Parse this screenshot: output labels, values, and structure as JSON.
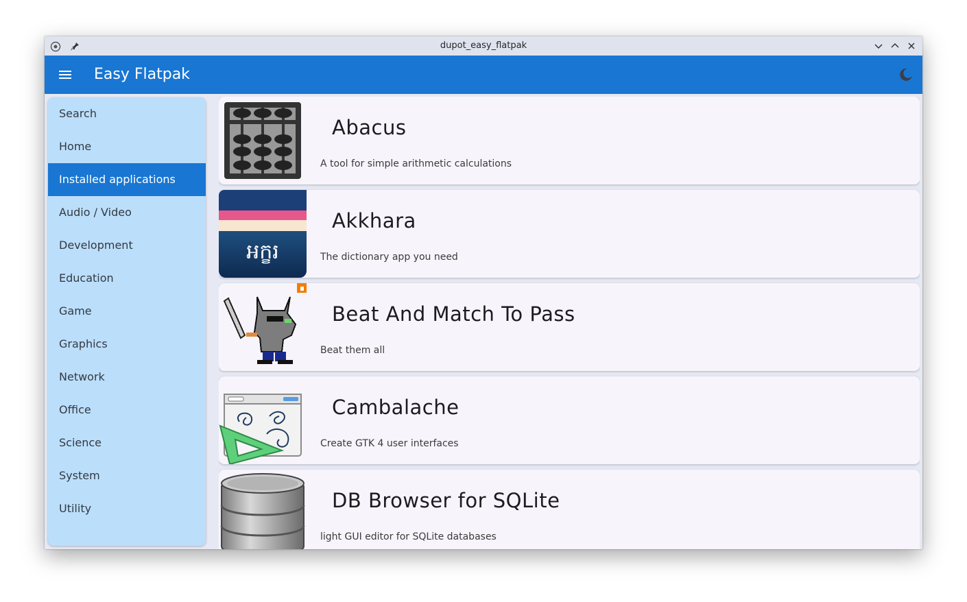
{
  "window": {
    "title": "dupot_easy_flatpak"
  },
  "appbar": {
    "title": "Easy Flatpak"
  },
  "sidebar": {
    "items": [
      {
        "label": "Search"
      },
      {
        "label": "Home"
      },
      {
        "label": "Installed applications",
        "active": true
      },
      {
        "label": "Audio / Video"
      },
      {
        "label": "Development"
      },
      {
        "label": "Education"
      },
      {
        "label": "Game"
      },
      {
        "label": "Graphics"
      },
      {
        "label": "Network"
      },
      {
        "label": "Office"
      },
      {
        "label": "Science"
      },
      {
        "label": "System"
      },
      {
        "label": "Utility"
      }
    ]
  },
  "apps": [
    {
      "name": "Abacus",
      "description": "A tool for simple arithmetic calculations",
      "icon": "abacus-icon"
    },
    {
      "name": "Akkhara",
      "description": "The dictionary app you need",
      "icon": "akkhara-icon",
      "icon_text": "អក្ខរ"
    },
    {
      "name": "Beat And Match To Pass",
      "description": "Beat them all",
      "icon": "pixel-cat-warrior-icon"
    },
    {
      "name": "Cambalache",
      "description": "Create GTK 4 user interfaces",
      "icon": "cambalache-icon"
    },
    {
      "name": "DB Browser for SQLite",
      "description": "light GUI editor for SQLite databases",
      "icon": "database-icon"
    }
  ],
  "colors": {
    "primary": "#1976d2",
    "sidebar": "#bbdefb",
    "card": "#f7f5fb"
  }
}
